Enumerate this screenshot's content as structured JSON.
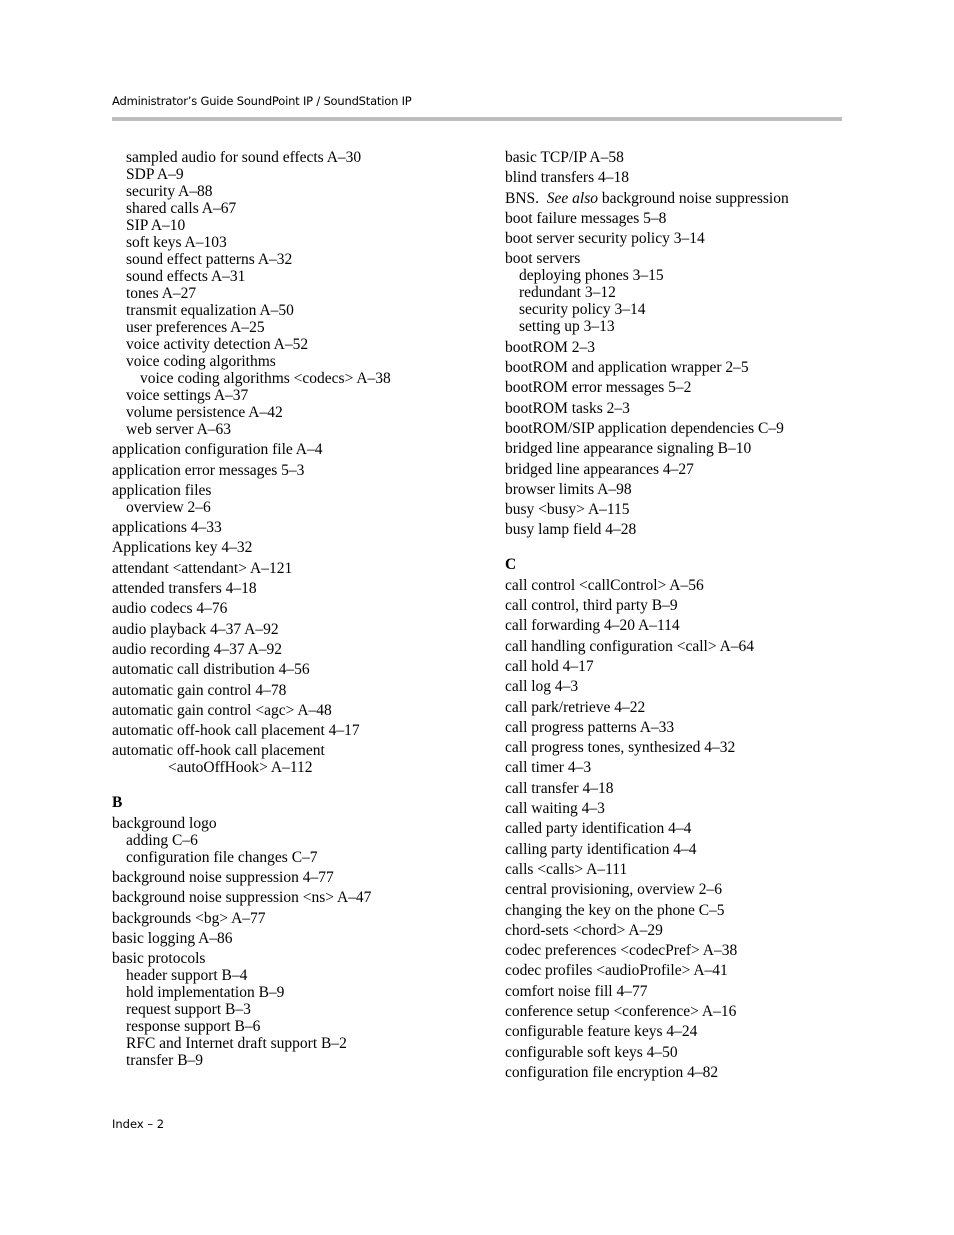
{
  "header": {
    "title": "Administrator’s Guide SoundPoint IP / SoundStation IP"
  },
  "footer": {
    "folio": "Index – 2"
  },
  "left_column": {
    "continued_subentries": [
      "sampled audio for sound effects A–30",
      "SDP A–9",
      "security A–88",
      "shared calls A–67",
      "SIP A–10",
      "soft keys A–103",
      "sound effect patterns A–32",
      "sound effects A–31",
      "tones A–27",
      "transmit equalization A–50",
      "user preferences A–25",
      "voice activity detection A–52",
      "voice coding algorithms"
    ],
    "nested_subentry": "voice coding algorithms <codecs> A–38",
    "continued_subentries_2": [
      "voice settings A–37",
      "volume persistence A–42",
      "web server A–63"
    ],
    "a_entries": [
      "application configuration file A–4",
      "application error messages 5–3",
      "application files"
    ],
    "application_files_sub": "overview 2–6",
    "a_entries_2": [
      "applications 4–33",
      "Applications key 4–32",
      "attendant <attendant> A–121",
      "attended transfers 4–18",
      "audio codecs 4–76",
      "audio playback 4–37  A–92",
      "audio recording 4–37  A–92",
      "automatic call distribution 4–56",
      "automatic gain control 4–78",
      "automatic gain control <agc> A–48",
      "automatic off-hook call placement 4–17",
      "automatic off-hook call placement"
    ],
    "auto_offhook_continuation": "<autoOffHook> A–112",
    "section_b_letter": "B",
    "background_logo": "background logo",
    "background_logo_sub": [
      "adding C–6",
      "configuration file changes C–7"
    ],
    "b_entries": [
      "background noise suppression 4–77",
      "background noise suppression <ns> A–47",
      "backgrounds <bg> A–77",
      "basic logging A–86",
      "basic protocols"
    ],
    "basic_protocols_sub": [
      "header support B–4",
      "hold implementation B–9",
      "request support B–3",
      "response support B–6",
      "RFC and Internet draft support B–2",
      "transfer B–9"
    ]
  },
  "right_column": {
    "b_entries_1": [
      "basic TCP/IP A–58",
      "blind transfers 4–18"
    ],
    "bns": {
      "term": "BNS.",
      "see_also": "See also",
      "target": "background noise suppression"
    },
    "b_entries_2": [
      "boot failure messages 5–8",
      "boot server security policy 3–14",
      "boot servers"
    ],
    "boot_servers_sub": [
      "deploying phones 3–15",
      "redundant 3–12",
      "security policy 3–14",
      "setting up 3–13"
    ],
    "b_entries_3": [
      "bootROM 2–3",
      "bootROM and application wrapper 2–5",
      "bootROM error messages 5–2",
      "bootROM tasks 2–3",
      "bootROM/SIP application dependencies C–9",
      "bridged line appearance signaling B–10",
      "bridged line appearances 4–27",
      "browser limits A–98",
      "busy <busy> A–115",
      "busy lamp field 4–28"
    ],
    "section_c_letter": "C",
    "c_entries": [
      "call control <callControl> A–56",
      "call control, third party B–9",
      "call forwarding 4–20  A–114",
      "call handling configuration <call> A–64",
      "call hold 4–17",
      "call log 4–3",
      "call park/retrieve 4–22",
      "call progress patterns A–33",
      "call progress tones, synthesized 4–32",
      "call timer 4–3",
      "call transfer 4–18",
      "call waiting 4–3",
      "called party identification 4–4",
      "calling party identification 4–4",
      "calls <calls> A–111",
      "central provisioning, overview 2–6",
      "changing the key on the phone C–5",
      "chord-sets <chord> A–29",
      "codec preferences <codecPref> A–38",
      "codec profiles <audioProfile> A–41",
      "comfort noise fill 4–77",
      "conference setup <conference> A–16",
      "configurable feature keys 4–24",
      "configurable soft keys 4–50",
      "configuration file encryption 4–82"
    ]
  }
}
